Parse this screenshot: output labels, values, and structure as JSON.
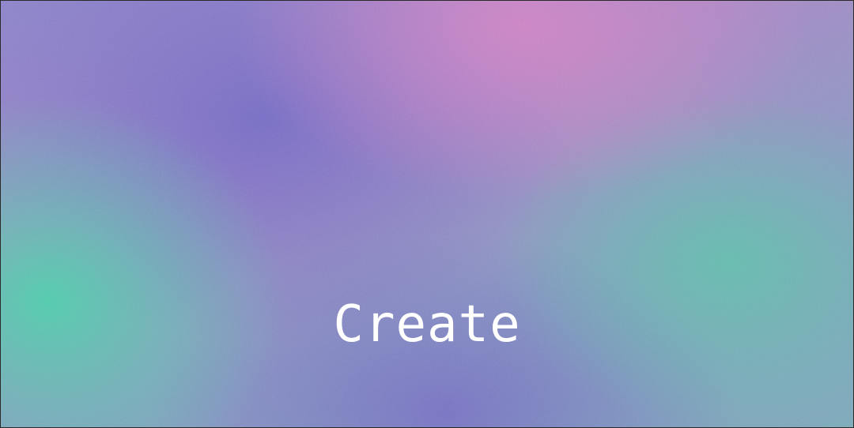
{
  "banner": {
    "title": "Create",
    "colors": {
      "pink": "#ce82c4",
      "violet": "#746cc4",
      "teal": "#50ceaa",
      "text": "#ffffff"
    }
  }
}
